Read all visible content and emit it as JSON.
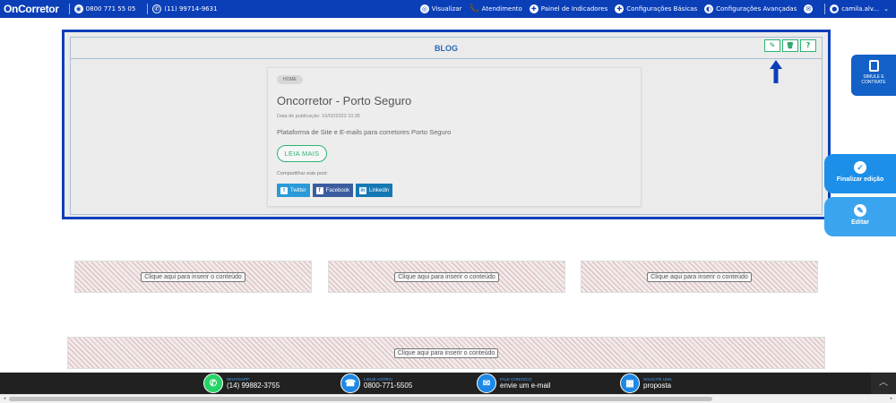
{
  "topbar": {
    "brand": "OnCorretor",
    "phone": "0800 771 55 05",
    "whatsapp": "(11) 99714-9631",
    "menu": [
      {
        "label": "Visualizar",
        "icon": "eye-icon"
      },
      {
        "label": "Atendimento",
        "icon": "phone-icon"
      },
      {
        "label": "Painel de Indicadores",
        "icon": "chart-icon"
      },
      {
        "label": "Configurações Básicas",
        "icon": "settings-icon"
      },
      {
        "label": "Configurações Avançadas",
        "icon": "advanced-settings-icon"
      }
    ],
    "user": "camila.alv..."
  },
  "blog": {
    "section_title": "BLOG",
    "tools": {
      "edit_icon": "✎",
      "delete_icon": "🗑",
      "help_label": "?"
    },
    "post": {
      "tag": "HOME",
      "title": "Oncorretor - Porto Seguro",
      "date": "Data de publicação: 16/02/2023 10:35",
      "description": "Plataforma de Site e E-mails para corretores Porto Seguro",
      "read_more": "LEIA MAIS",
      "share_label": "Compartilhar este post:",
      "share": {
        "twitter": "Twitter",
        "facebook": "Facebook",
        "linkedin": "Linkedin"
      }
    }
  },
  "placeholders": {
    "label": "Clique aqui para inserir o conteúdo"
  },
  "side": {
    "simule": "SIMULE E CONTRATE",
    "finalize": "Finalizar edição",
    "edit": "Editar"
  },
  "footer": {
    "whatsapp": {
      "small": "WHATSAPP:",
      "big": "(14) 99882-3755"
    },
    "call": {
      "small": "LIGUE AGORA!",
      "big": "0800-771-5505"
    },
    "contact": {
      "small": "FALE CONOSCO",
      "big": "envie um e-mail"
    },
    "quote": {
      "small": "SOLICITE UMA",
      "big": "proposta"
    }
  },
  "colors": {
    "primary": "#0b3fb8",
    "accent_green": "#2bb673",
    "footer_bg": "#212121"
  }
}
